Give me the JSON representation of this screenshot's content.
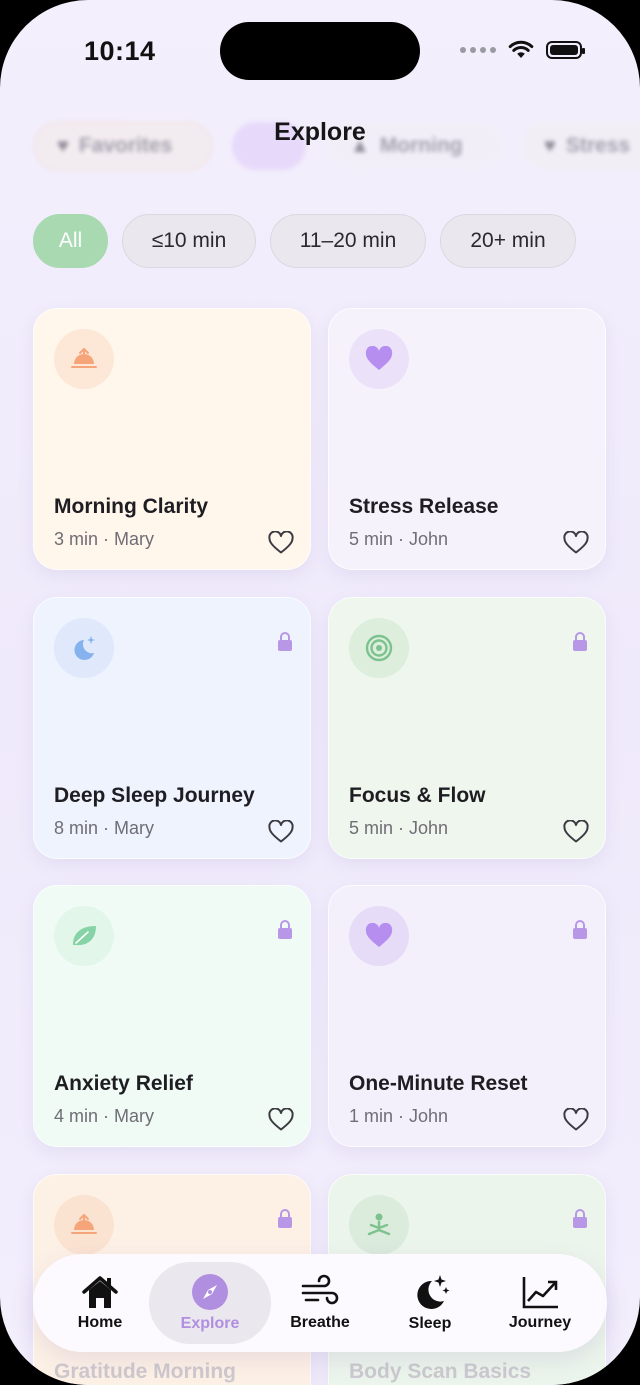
{
  "status_bar": {
    "time": "10:14"
  },
  "header": {
    "title": "Explore"
  },
  "categories": [
    {
      "label": "Favorites",
      "icon": "heart-icon"
    },
    {
      "label": "",
      "icon": ""
    },
    {
      "label": "Morning",
      "icon": "sunrise-icon"
    },
    {
      "label": "Stress",
      "icon": "heart-icon"
    }
  ],
  "duration_filters": [
    "All",
    "≤10 min",
    "11–20 min",
    "20+ min"
  ],
  "active_filter": "All",
  "sessions": [
    {
      "title": "Morning Clarity",
      "meta": "3 min · Mary",
      "icon": "sunrise-icon",
      "locked": false,
      "bg": "#fff6ec",
      "icon_bg": "#fde8d8",
      "icon_color": "#f6a47a"
    },
    {
      "title": "Stress Release",
      "meta": "5 min · John",
      "icon": "heart-icon",
      "locked": false,
      "bg": "#f6f2fc",
      "icon_bg": "#ebe2fa",
      "icon_color": "#b58ef0"
    },
    {
      "title": "Deep Sleep Journey",
      "meta": "8 min · Mary",
      "icon": "moon-stars-icon",
      "locked": true,
      "bg": "#eef3fd",
      "icon_bg": "#dfe9fb",
      "icon_color": "#86b2f0"
    },
    {
      "title": "Focus & Flow",
      "meta": "5 min · John",
      "icon": "target-icon",
      "locked": true,
      "bg": "#eef6ee",
      "icon_bg": "#ddeedd",
      "icon_color": "#7cc28e"
    },
    {
      "title": "Anxiety Relief",
      "meta": "4 min · Mary",
      "icon": "leaf-icon",
      "locked": true,
      "bg": "#f0fbf5",
      "icon_bg": "#e2f6e9",
      "icon_color": "#86d3a5"
    },
    {
      "title": "One-Minute Reset",
      "meta": "1 min · John",
      "icon": "heart-icon",
      "locked": true,
      "bg": "#f4f0fb",
      "icon_bg": "#e6dcf8",
      "icon_color": "#b58ef0"
    },
    {
      "title": "Gratitude Morning",
      "meta": "",
      "icon": "sunrise-icon",
      "locked": true,
      "bg": "#fdf1e6",
      "icon_bg": "#fbe3d2",
      "icon_color": "#f6a47a"
    },
    {
      "title": "Body Scan Basics",
      "meta": "",
      "icon": "meditate-icon",
      "locked": true,
      "bg": "#ecf5ec",
      "icon_bg": "#dbebdc",
      "icon_color": "#7cc28e"
    }
  ],
  "tabbar": {
    "home": "Home",
    "explore": "Explore",
    "breathe": "Breathe",
    "sleep": "Sleep",
    "journey": "Journey",
    "active": "Explore",
    "accent_color": "#b08ee0"
  }
}
